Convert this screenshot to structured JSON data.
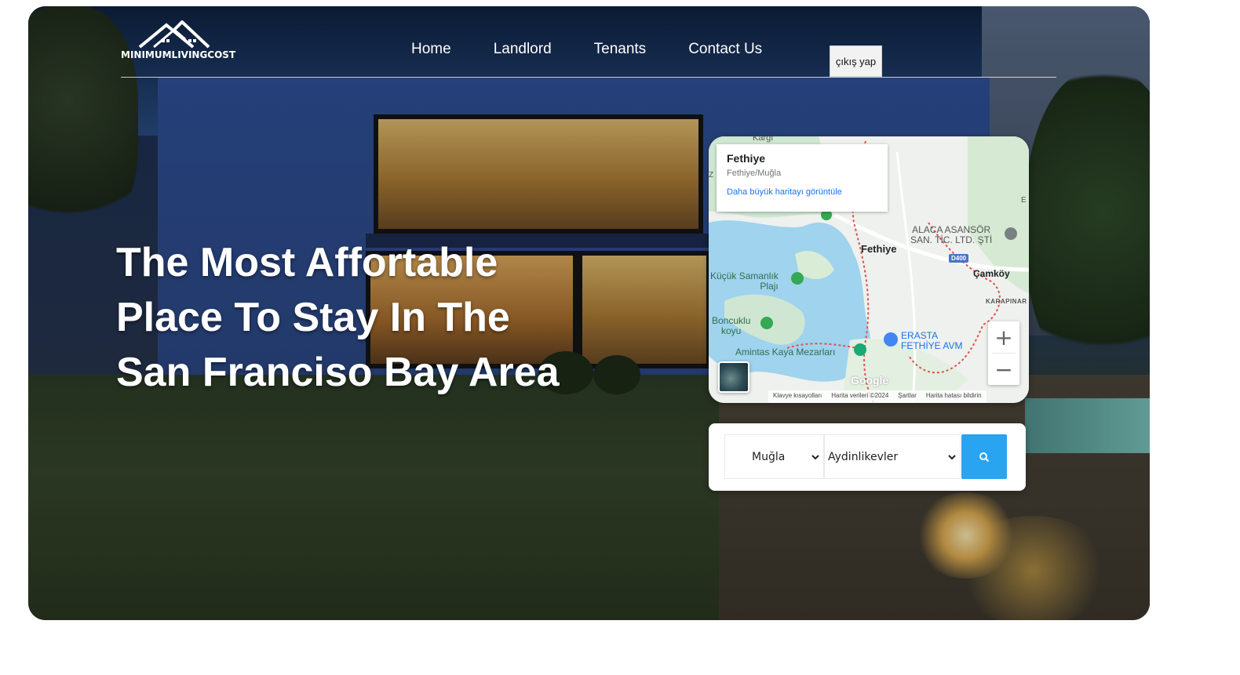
{
  "brand": {
    "logo_text": "MINIMUMLIVINGCOST"
  },
  "nav": {
    "items": [
      "Home",
      "Landlord",
      "Tenants",
      "Contact Us"
    ],
    "logout_label": "çıkış yap"
  },
  "hero": {
    "headline_lines": [
      "The Most Affortable",
      "Place To Stay In The",
      "San Franciso Bay Area"
    ]
  },
  "map": {
    "info": {
      "title": "Fethiye",
      "subtitle": "Fethiye/Muğla",
      "link": "Daha büyük haritayı görüntüle"
    },
    "labels": {
      "kargi": "Kargı",
      "fethiye": "Fethiye",
      "camkoy": "Çamköy",
      "karapinar": "KARAPINAR",
      "kucuk": [
        "Küçük Samanlık",
        "Plajı"
      ],
      "boncuklu": [
        "Boncuklu",
        "koyu"
      ],
      "amintas": "Amintas Kaya Mezarları",
      "asansor": [
        "ALACA ASANSÖR",
        "SAN. TİC. LTD. ŞTİ"
      ],
      "erasta": [
        "ERASTA",
        "FETHİYE AVM"
      ],
      "road": "D400",
      "edge_e": "E",
      "edge_z": "Z"
    },
    "google": "Google",
    "attribution": [
      "Klavye kısayolları",
      "Harita verileri ©2024",
      "Şartlar",
      "Harita hatası bildirin"
    ],
    "zoom_in": "+",
    "zoom_out": "−"
  },
  "search": {
    "province": "Muğla",
    "district": "Aydinlikevler",
    "button_icon": "search-icon"
  },
  "colors": {
    "accent": "#28a4f0",
    "map_water": "#9fd3ee",
    "map_land": "#eef1ee"
  }
}
